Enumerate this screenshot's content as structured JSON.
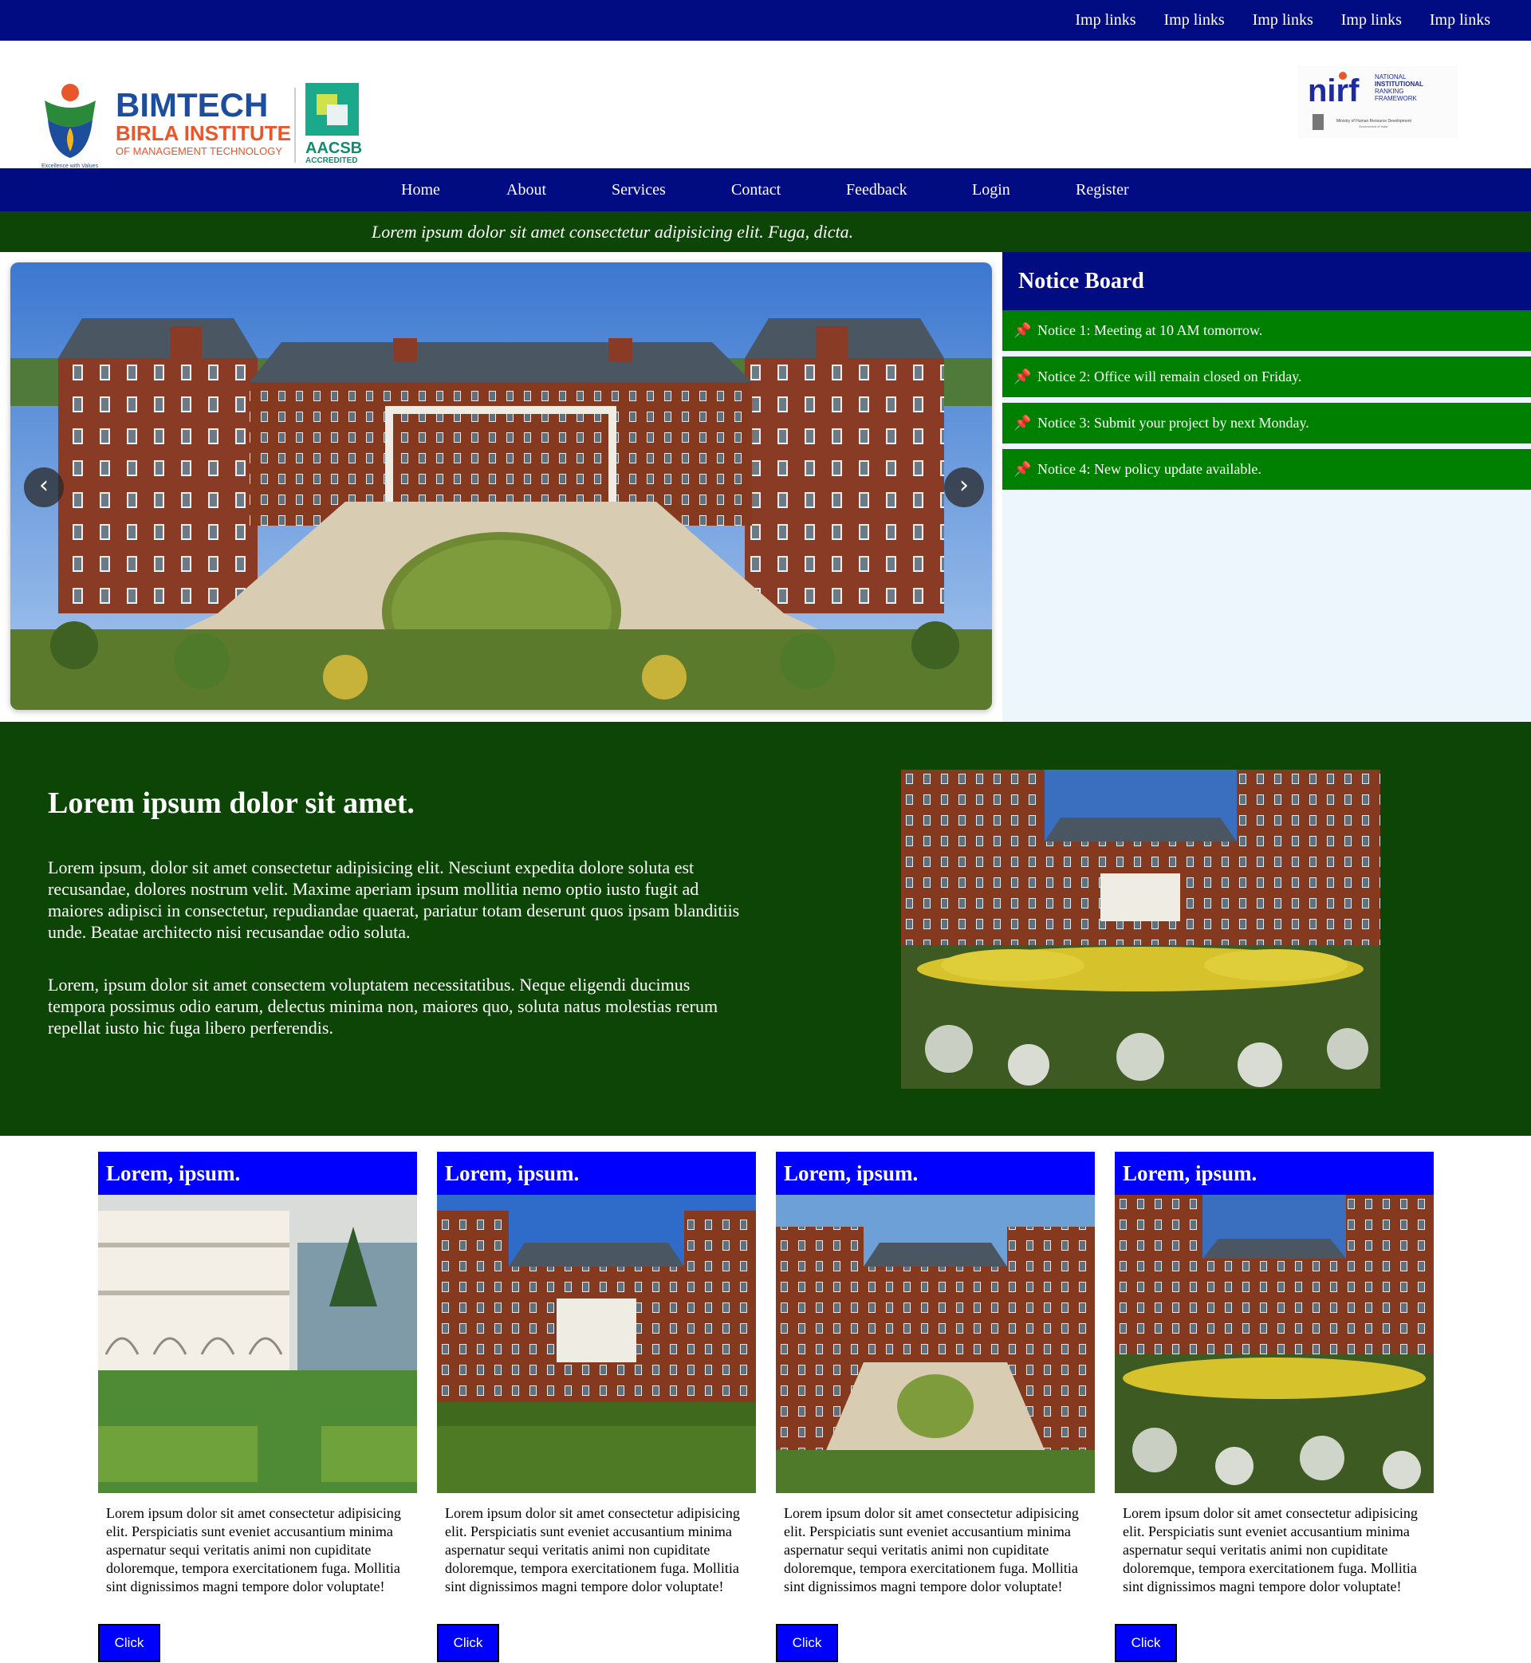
{
  "topbar": {
    "links": [
      "Imp links",
      "Imp links",
      "Imp links",
      "Imp links",
      "Imp links"
    ]
  },
  "header": {
    "logo_left": {
      "name": "BIMTECH",
      "line2": "BIRLA INSTITUTE",
      "line3": "OF MANAGEMENT TECHNOLOGY",
      "tagline": "Excellence with Values",
      "badge": "AACSB",
      "badge_sub": "ACCREDITED"
    },
    "logo_right": {
      "name": "nirf",
      "line1": "NATIONAL",
      "line2": "INSTITUTIONAL",
      "line3": "RANKING",
      "line4": "FRAMEWORK",
      "ministry": "Ministry of Human Resource Development",
      "govt": "Government of India"
    }
  },
  "nav": {
    "items": [
      "Home",
      "About",
      "Services",
      "Contact",
      "Feedback",
      "Login",
      "Register"
    ]
  },
  "strip": {
    "text": "Lorem ipsum dolor sit amet consectetur adipisicing elit. Fuga, dicta."
  },
  "slider": {
    "prev": "‹",
    "next": "›"
  },
  "notice_board": {
    "title": "Notice Board",
    "items": [
      "Notice 1: Meeting at 10 AM tomorrow.",
      "Notice 2: Office will remain closed on Friday.",
      "Notice 3: Submit your project by next Monday.",
      "Notice 4: New policy update available."
    ]
  },
  "about": {
    "heading": "Lorem ipsum dolor sit amet.",
    "paragraphs": [
      "Lorem ipsum, dolor sit amet consectetur adipisicing elit. Nesciunt expedita dolore soluta est recusandae, dolores nostrum velit. Maxime aperiam ipsum mollitia nemo optio iusto fugit ad maiores adipisci in consectetur, repudiandae quaerat, pariatur totam deserunt quos ipsam blanditiis unde. Beatae architecto nisi recusandae odio soluta.",
      "Lorem, ipsum dolor sit amet consectem voluptatem necessitatibus. Neque eligendi ducimus tempora possimus odio earum, delectus minima non, maiores quo, soluta natus molestias rerum repellat iusto hic fuga libero perferendis."
    ]
  },
  "cards": [
    {
      "title": "Lorem, ipsum.",
      "text": "Lorem ipsum dolor sit amet consectetur adipisicing elit. Perspiciatis sunt eveniet accusantium minima aspernatur sequi veritatis animi non cupiditate doloremque, tempora exercitationem fuga. Mollitia sint dignissimos magni tempore dolor voluptate!",
      "button": "Click"
    },
    {
      "title": "Lorem, ipsum.",
      "text": "Lorem ipsum dolor sit amet consectetur adipisicing elit. Perspiciatis sunt eveniet accusantium minima aspernatur sequi veritatis animi non cupiditate doloremque, tempora exercitationem fuga. Mollitia sint dignissimos magni tempore dolor voluptate!",
      "button": "Click"
    },
    {
      "title": "Lorem, ipsum.",
      "text": "Lorem ipsum dolor sit amet consectetur adipisicing elit. Perspiciatis sunt eveniet accusantium minima aspernatur sequi veritatis animi non cupiditate doloremque, tempora exercitationem fuga. Mollitia sint dignissimos magni tempore dolor voluptate!",
      "button": "Click"
    },
    {
      "title": "Lorem, ipsum.",
      "text": "Lorem ipsum dolor sit amet consectetur adipisicing elit. Perspiciatis sunt eveniet accusantium minima aspernatur sequi veritatis animi non cupiditate doloremque, tempora exercitationem fuga. Mollitia sint dignissimos magni tempore dolor voluptate!",
      "button": "Click"
    }
  ],
  "colors": {
    "navy": "#010b82",
    "dark_green": "#0c4505",
    "green": "#008000",
    "blue": "#0000ff",
    "notice_bg": "#eef6fd"
  },
  "icons": {
    "pin": "pushpin-icon",
    "prev": "chevron-left-icon",
    "next": "chevron-right-icon"
  }
}
